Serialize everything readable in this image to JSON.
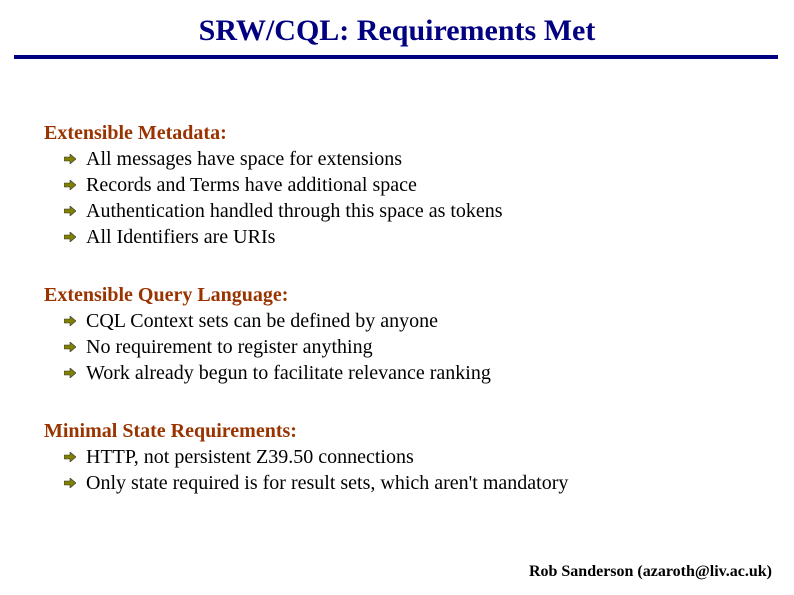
{
  "title": "SRW/CQL:  Requirements Met",
  "sections": [
    {
      "heading": "Extensible Metadata:",
      "bullets": [
        "All messages have space for extensions",
        "Records and Terms have additional space",
        "Authentication handled through this space as tokens",
        "All Identifiers are URIs"
      ]
    },
    {
      "heading": "Extensible Query Language:",
      "bullets": [
        "CQL Context sets can be defined by anyone",
        "No requirement to register anything",
        "Work already begun to facilitate relevance ranking"
      ]
    },
    {
      "heading": "Minimal State Requirements:",
      "bullets": [
        "HTTP, not persistent Z39.50 connections",
        "Only state required is for result sets, which aren't mandatory"
      ]
    }
  ],
  "footer": "Rob Sanderson (azaroth@liv.ac.uk)",
  "colors": {
    "accent_navy": "#000080",
    "section_brown": "#993300",
    "arrow_olive": "#808000",
    "arrow_outline": "#333333"
  }
}
